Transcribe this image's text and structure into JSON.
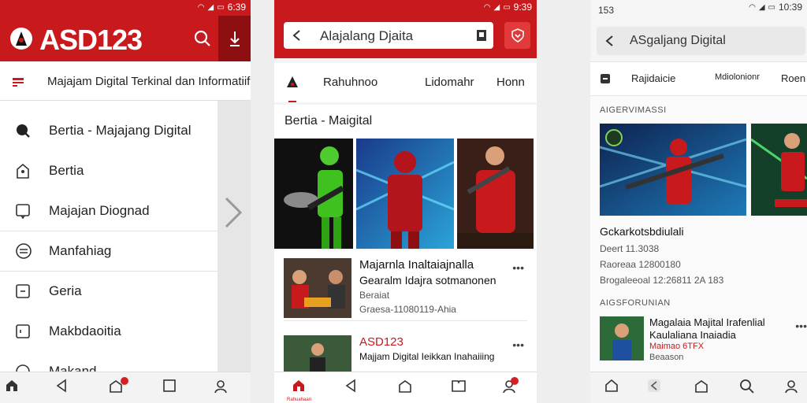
{
  "colors": {
    "brand_red": "#c8191d",
    "dark_red": "#8e0f12",
    "text": "#222222"
  },
  "phone1": {
    "status_time": "6:39",
    "brand": "ASD123",
    "tagline": "Majajam Digital Terkinal dan Informatiif",
    "drawer": [
      {
        "label": "Bertia - Majajang Digital",
        "icon": "pin-icon"
      },
      {
        "label": "Bertia",
        "icon": "home-outline-icon"
      },
      {
        "label": "Majajan Diognad",
        "icon": "message-icon"
      },
      {
        "label": "Manfahiag",
        "icon": "list-circle-icon"
      },
      {
        "label": "Geria",
        "icon": "square-icon"
      },
      {
        "label": "Makbdaoitia",
        "icon": "square-icon"
      },
      {
        "label": "Makand",
        "icon": "circle-icon"
      }
    ]
  },
  "phone2": {
    "status_time": "9:39",
    "search_text": "Alajalang Djaita",
    "tabs": [
      "Rahuhnoo",
      "Lidomahr",
      "Honn"
    ],
    "section": "Bertia - Maigital",
    "articles": [
      {
        "title1": "Majarnla Inaltaiajnalla",
        "title2": "Gearalm Idajra sotmanonen",
        "tag": "Beraiat",
        "meta": "Graesa-11080119-Ahia"
      },
      {
        "title1": "ASD123",
        "title2": "Majjam Digital Ieikkan Inahaiiing",
        "tag": "",
        "meta": ""
      }
    ],
    "bottom_active_label": "Rahuahaan"
  },
  "phone3": {
    "status_time": "10:39",
    "status_left": "153",
    "search_text": "ASgaljang Digital",
    "tabs": [
      "Rajidaicie",
      "Mdiolonionr",
      "Roen"
    ],
    "section1": "AIGERVIMASSI",
    "headline": "Gckarkotsbdiulali",
    "meta_lines": [
      "Deert 11.3038",
      "Raoreaa 12800180",
      "Brogaleeoal 12:26811 2A 183"
    ],
    "section2": "AIGSFORUNIAN",
    "article": {
      "title1": "Magalaia Majital Irafenlial",
      "title2": "Kaulaliana Inaiadia",
      "meta1": "Maimao 6TFX",
      "meta2": "Beaason"
    }
  },
  "nav_more": "•••"
}
